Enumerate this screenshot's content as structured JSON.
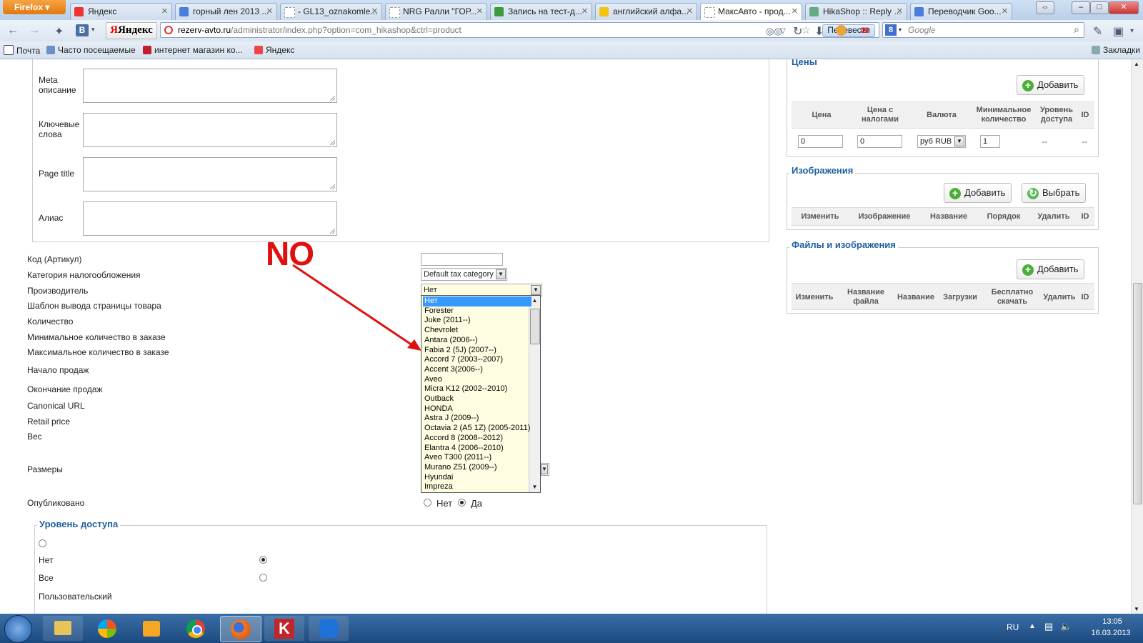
{
  "browser": {
    "menu_button": "Firefox",
    "tabs": [
      {
        "label": "Яндекс",
        "active": false
      },
      {
        "label": "горный лен 2013 ...",
        "active": false
      },
      {
        "label": "- GL13_oznakomle...",
        "active": false
      },
      {
        "label": "NRG Ралли \"ГОР...",
        "active": false
      },
      {
        "label": "Запись на тест-д...",
        "active": false
      },
      {
        "label": "английский алфа...",
        "active": false
      },
      {
        "label": "МаксАвто - прод...",
        "active": true
      },
      {
        "label": "HikaShop :: Reply ...",
        "active": false
      },
      {
        "label": "Переводчик Goo...",
        "active": false
      }
    ],
    "yandex_button": "Яндекс",
    "url_domain": "rezerv-avto.ru",
    "url_path": "/administrator/index.php?option=com_hikashop&ctrl=product",
    "translate_button": "Перевести",
    "search_placeholder": "Google",
    "bookmarks": [
      "Почта",
      "Часто посещаемые",
      "интернет магазин ко...",
      "Яндекс"
    ],
    "bookmarks_right": "Закладки"
  },
  "left_form": {
    "meta_fields": [
      "Meta описание",
      "Ключевые слова",
      "Page title",
      "Алиас"
    ],
    "fields": [
      "Код (Артикул)",
      "Категория налогообложения",
      "Производитель",
      "Шаблон вывода страницы товара",
      "Количество",
      "Минимальное количество в заказе",
      "Максимальное количество в заказе",
      "Начало продаж",
      "Окончание продаж",
      "Canonical URL",
      "Retail price",
      "Вес",
      "Размеры",
      "Опубликовано"
    ],
    "tax_category_value": "Default tax category",
    "manufacturer_value": "Нет",
    "published_options": [
      "Нет",
      "Да"
    ],
    "published_selected": "Да",
    "access_level": {
      "legend": "Уровень доступа",
      "options": [
        "",
        "Нет",
        "Все",
        "Пользовательский"
      ],
      "selected": "Нет"
    }
  },
  "dropdown_options": [
    "Нет",
    "Forester",
    "Juke (2011--)",
    "Chevrolet",
    "Antara (2006--)",
    "Fabia 2 (5J) (2007--)",
    "Accord 7 (2003--2007)",
    "Accent 3(2006--)",
    "Aveo",
    "Micra K12 (2002--2010)",
    "Outback",
    "HONDA",
    "Astra J (2009--)",
    "Octavia 2 (A5 1Z) (2005-2011)",
    "Accord 8 (2008--2012)",
    "Elantra 4 (2006--2010)",
    "Aveo T300 (2011--)",
    "Murano Z51 (2009--)",
    "Hyundai",
    "Impreza"
  ],
  "annotation": "NO",
  "prices": {
    "legend": "Цены",
    "add_button": "Добавить",
    "headers": [
      "Цена",
      "Цена с налогами",
      "Валюта",
      "Минимальное количество",
      "Уровень доступа",
      "ID"
    ],
    "row": {
      "price": "0",
      "price_tax": "0",
      "currency": "руб RUB",
      "min_qty": "1",
      "access": "--",
      "id": "--"
    }
  },
  "images": {
    "legend": "Изображения",
    "add_button": "Добавить",
    "select_button": "Выбрать",
    "headers": [
      "Изменить",
      "Изображение",
      "Название",
      "Порядок",
      "Удалить",
      "ID"
    ]
  },
  "files": {
    "legend": "Файлы и изображения",
    "add_button": "Добавить",
    "headers": [
      "Изменить",
      "Название файла",
      "Название",
      "Загрузки",
      "Бесплатно скачать",
      "Удалить",
      "ID"
    ]
  },
  "taskbar": {
    "lang": "RU",
    "time": "13:05",
    "date": "16.03.2013"
  }
}
